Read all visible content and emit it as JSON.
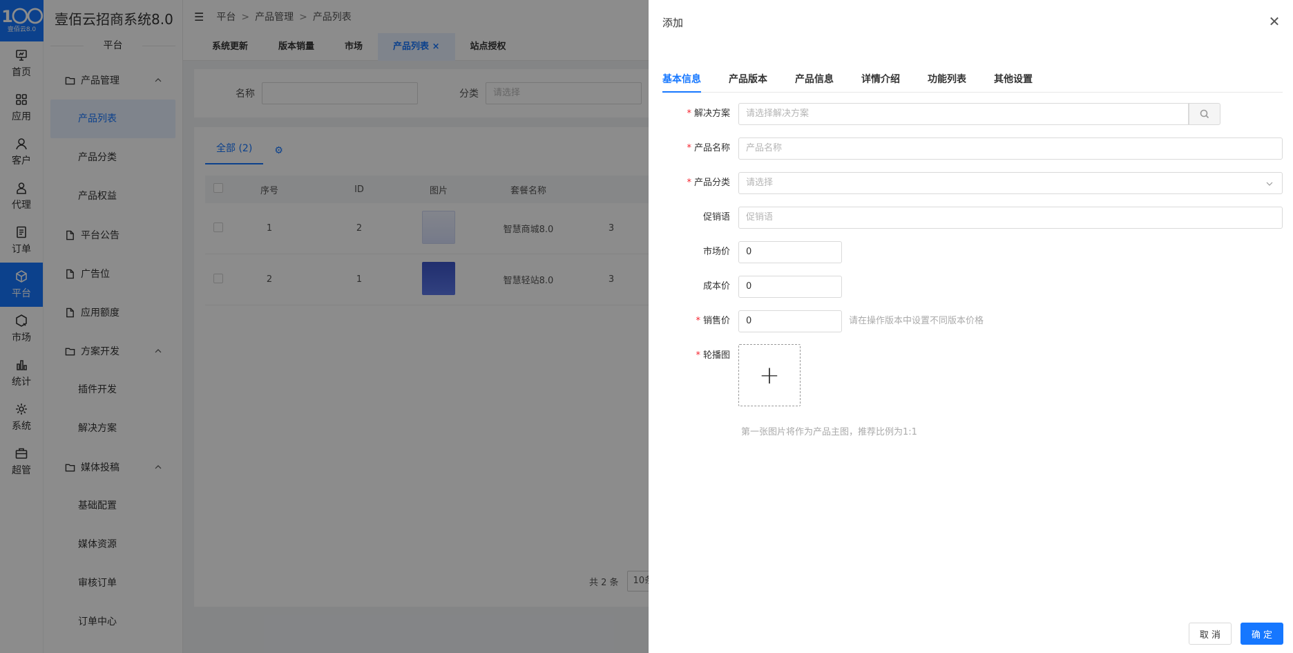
{
  "app": {
    "logo_text": "1〇〇",
    "logo_subtitle": "壹佰云8.0",
    "system_title": "壹佰云招商系统8.0",
    "section_title": "平台"
  },
  "rail": {
    "items": [
      {
        "label": "首页",
        "icon": "monitor-icon"
      },
      {
        "label": "应用",
        "icon": "grid-icon"
      },
      {
        "label": "客户",
        "icon": "user-icon"
      },
      {
        "label": "代理",
        "icon": "agent-icon"
      },
      {
        "label": "订单",
        "icon": "order-icon"
      },
      {
        "label": "平台",
        "icon": "cube-icon",
        "active": true
      },
      {
        "label": "市场",
        "icon": "market-icon"
      },
      {
        "label": "统计",
        "icon": "chart-icon"
      },
      {
        "label": "系统",
        "icon": "gear-icon"
      },
      {
        "label": "超管",
        "icon": "briefcase-icon"
      }
    ]
  },
  "sidebar": {
    "groups": [
      {
        "label": "产品管理",
        "icon": "folder-icon",
        "children": [
          "产品列表",
          "产品分类",
          "产品权益"
        ]
      },
      {
        "label": "平台公告",
        "icon": "file-icon"
      },
      {
        "label": "广告位",
        "icon": "file-icon"
      },
      {
        "label": "应用额度",
        "icon": "file-icon"
      },
      {
        "label": "方案开发",
        "icon": "folder-icon",
        "children": [
          "插件开发",
          "解决方案"
        ]
      },
      {
        "label": "媒体投稿",
        "icon": "folder-icon",
        "children": [
          "基础配置",
          "媒体资源",
          "审核订单",
          "订单中心"
        ]
      }
    ]
  },
  "breadcrumb": [
    "平台",
    "产品管理",
    "产品列表"
  ],
  "breadcrumb_sep": ">",
  "tabs": [
    "系统更新",
    "版本销量",
    "市场",
    "产品列表",
    "站点授权"
  ],
  "filter": {
    "name_label": "名称",
    "category_label": "分类",
    "category_placeholder": "请选择"
  },
  "list": {
    "tab_all": "全部 (2)",
    "columns": [
      "序号",
      "ID",
      "图片",
      "套餐名称"
    ],
    "rows": [
      {
        "index": "1",
        "id": "2",
        "name": "智慧商城8.0",
        "extra": "3"
      },
      {
        "index": "2",
        "id": "1",
        "name": "智慧轻站8.0",
        "extra": "3"
      }
    ],
    "total": "共 2 条",
    "page_size": "10条"
  },
  "drawer": {
    "title": "添加",
    "tabs": [
      "基本信息",
      "产品版本",
      "产品信息",
      "详情介绍",
      "功能列表",
      "其他设置"
    ],
    "fields": {
      "solution": {
        "label": "解决方案",
        "placeholder": "请选择解决方案"
      },
      "product_name": {
        "label": "产品名称",
        "placeholder": "产品名称"
      },
      "product_category": {
        "label": "产品分类",
        "placeholder": "请选择"
      },
      "promo": {
        "label": "促销语",
        "placeholder": "促销语"
      },
      "market_price": {
        "label": "市场价",
        "value": "0"
      },
      "cost_price": {
        "label": "成本价",
        "value": "0"
      },
      "sale_price": {
        "label": "销售价",
        "value": "0",
        "hint": "请在操作版本中设置不同版本价格"
      },
      "carousel": {
        "label": "轮播图",
        "hint": "第一张图片将作为产品主图，推荐比例为1:1"
      }
    },
    "cancel_label": "取 消",
    "ok_label": "确 定"
  },
  "colors": {
    "primary": "#1677ff",
    "required": "#f5222d"
  }
}
